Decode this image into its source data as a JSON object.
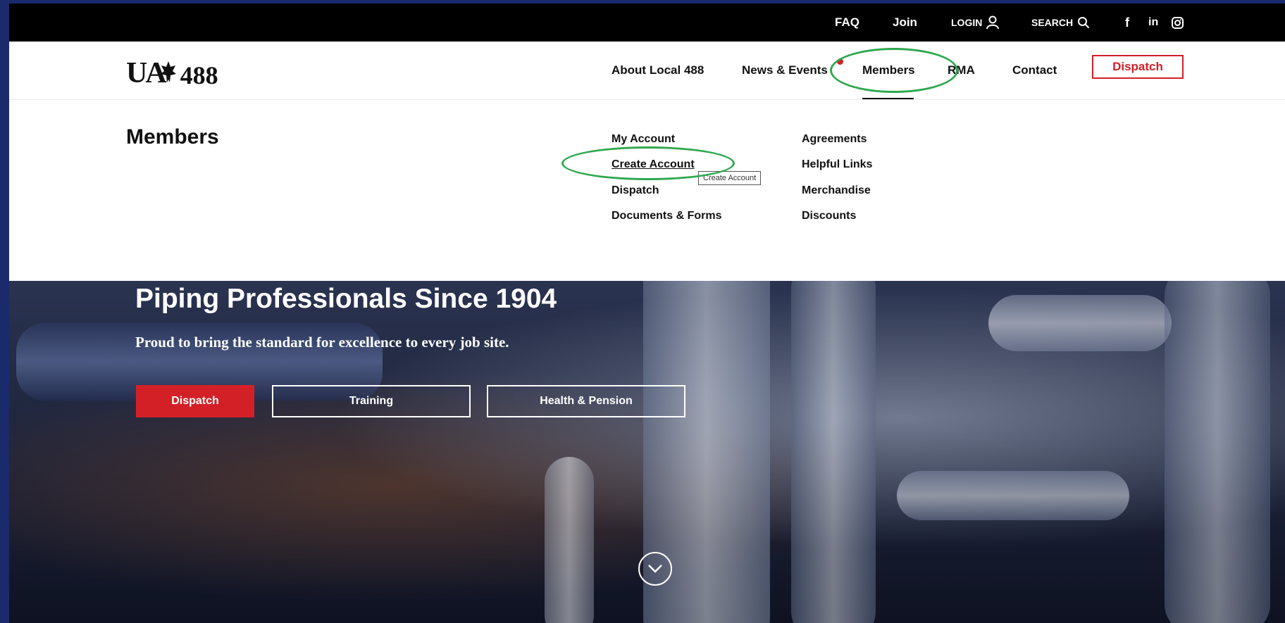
{
  "topbar": {
    "faq": "FAQ",
    "join": "Join",
    "login": "LOGIN",
    "search": "SEARCH",
    "social": [
      "facebook-icon",
      "linkedin-icon",
      "instagram-icon"
    ]
  },
  "header": {
    "logo_mark": "UA",
    "logo_number": "488",
    "nav": {
      "about": "About Local 488",
      "news": "News & Events",
      "members": "Members",
      "rma": "RMA",
      "contact": "Contact",
      "dispatch": "Dispatch"
    }
  },
  "dropdown": {
    "title": "Members",
    "col1": [
      "My Account",
      "Create Account",
      "Dispatch",
      "Documents & Forms"
    ],
    "col2": [
      "Agreements",
      "Helpful Links",
      "Merchandise",
      "Discounts"
    ],
    "tooltip": "Create Account"
  },
  "hero": {
    "title": "Piping Professionals Since 1904",
    "subtitle": "Proud to bring the standard for excellence to every job site.",
    "buttons": {
      "dispatch": "Dispatch",
      "training": "Training",
      "health": "Health & Pension"
    }
  },
  "colors": {
    "brand_red": "#d32027",
    "annotation_green": "#2fa84f",
    "topbar_bg": "#000000",
    "outer_bg": "#1b2a6b"
  }
}
